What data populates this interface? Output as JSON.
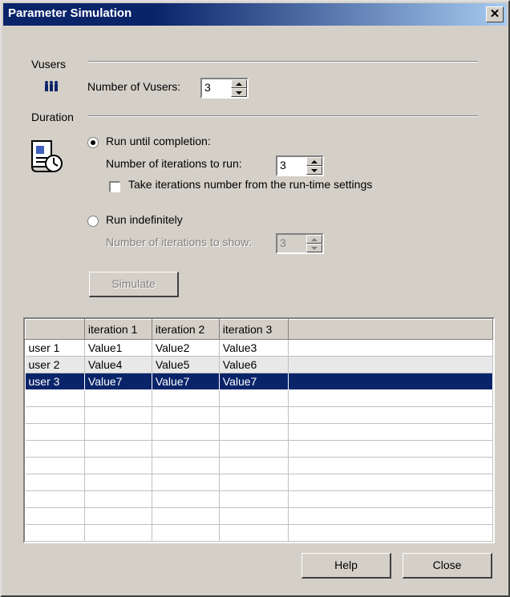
{
  "window": {
    "title": "Parameter Simulation",
    "close_glyph": "✕"
  },
  "vusers": {
    "section_label": "Vusers",
    "icon": "vusers-icon",
    "count_label": "Number of Vusers:",
    "count_value": "3"
  },
  "duration": {
    "section_label": "Duration",
    "icon": "schedule-clock-icon",
    "run_until_completion": {
      "label": "Run until completion:",
      "selected": true,
      "iterations_label": "Number of iterations to run:",
      "iterations_value": "3",
      "take_from_runtime_label": "Take iterations number from the run-time settings",
      "take_from_runtime_checked": false
    },
    "run_indefinitely": {
      "label": "Run indefinitely",
      "selected": false,
      "iterations_show_label": "Number of iterations to show:",
      "iterations_show_value": "3"
    }
  },
  "simulate_button": {
    "label": "Simulate",
    "enabled": false
  },
  "grid": {
    "columns": [
      "",
      "iteration 1",
      "iteration 2",
      "iteration 3",
      ""
    ],
    "rows": [
      [
        "user 1",
        "Value1",
        "Value2",
        "Value3",
        ""
      ],
      [
        "user 2",
        "Value4",
        "Value5",
        "Value6",
        ""
      ],
      [
        "user 3",
        "Value7",
        "Value7",
        "Value7",
        ""
      ]
    ],
    "selected_row": 2
  },
  "buttons": {
    "help": "Help",
    "close": "Close"
  },
  "colors": {
    "title_bar": "#0a246a",
    "selection": "#0a246a",
    "face": "#d4d0c8"
  }
}
